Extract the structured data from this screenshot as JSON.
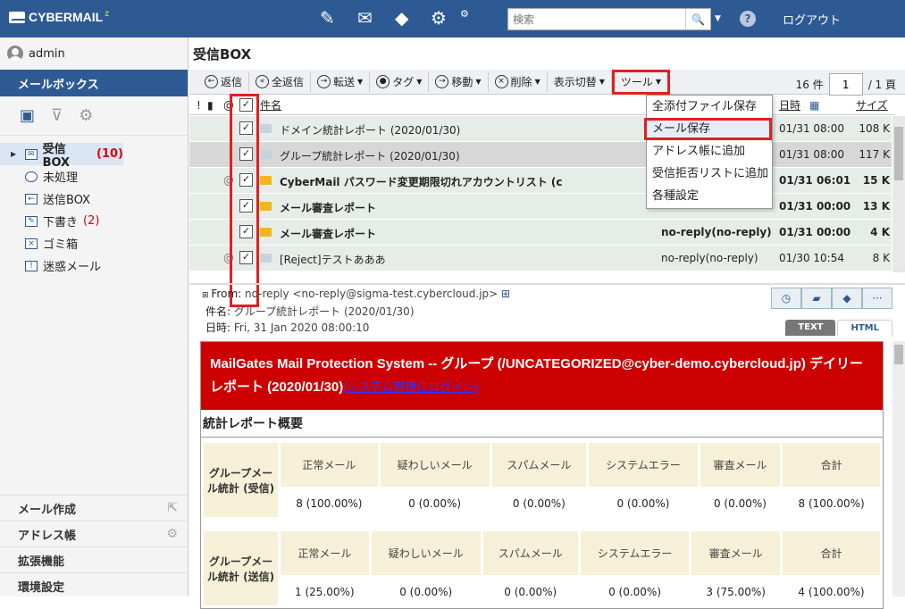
{
  "app": {
    "logo": "CYBERMAIL",
    "search_placeholder": "検索",
    "logout": "ログアウト",
    "help": "?"
  },
  "user": "admin",
  "sidebar": {
    "mailbox_title": "メールボックス",
    "folders": [
      {
        "label": "受信BOX",
        "count": "(10)"
      },
      {
        "label": "未処理",
        "count": ""
      },
      {
        "label": "送信BOX",
        "count": ""
      },
      {
        "label": "下書き",
        "count": "(2)"
      },
      {
        "label": "ゴミ箱",
        "count": ""
      },
      {
        "label": "迷惑メール",
        "count": ""
      }
    ],
    "bottom": [
      "メール作成",
      "アドレス帳",
      "拡張機能",
      "環境設定"
    ]
  },
  "main": {
    "title": "受信BOX",
    "toolbar": {
      "reply": "返信",
      "reply_all": "全返信",
      "forward": "転送",
      "tag": "タグ",
      "move": "移動",
      "delete": "削除",
      "view": "表示切替",
      "tools": "ツール"
    },
    "pager": {
      "count": "16 件",
      "page": "1",
      "total": "/ 1 頁"
    },
    "columns": {
      "subject": "件名",
      "date": "日時",
      "size": "サイズ"
    },
    "rows": [
      {
        "subject": "ドメイン統計レポート (2020/01/30)",
        "from": "",
        "date": "01/31 08:00",
        "size": "108 K",
        "bold": false,
        "att": ""
      },
      {
        "subject": "グループ統計レポート (2020/01/30)",
        "from": "",
        "date": "01/31 08:00",
        "size": "117 K",
        "bold": false,
        "att": ""
      },
      {
        "subject": "CyberMail パスワード変更期限切れアカウントリスト (c",
        "from": "",
        "date": "01/31 06:01",
        "size": "15 K",
        "bold": true,
        "att": "@"
      },
      {
        "subject": "メール審査レポート",
        "from": "",
        "date": "01/31 00:00",
        "size": "13 K",
        "bold": true,
        "att": ""
      },
      {
        "subject": "メール審査レポート",
        "from": "no-reply(no-reply)",
        "date": "01/31 00:00",
        "size": "4 K",
        "bold": true,
        "att": ""
      },
      {
        "subject": "[Reject]テストあああ",
        "from": "no-reply(no-reply)",
        "date": "01/30 10:54",
        "size": "8 K",
        "bold": false,
        "att": "@"
      }
    ],
    "tool_menu": [
      "全添付ファイル保存",
      "メール保存",
      "アドレス帳に追加",
      "受信拒否リストに追加",
      "各種設定"
    ]
  },
  "preview": {
    "from_label": "From:",
    "from": "no-reply <no-reply@sigma-test.cybercloud.jp>",
    "subject_label": "件名:",
    "subject": "グループ統計レポート (2020/01/30)",
    "date_label": "日時:",
    "date": "Fri, 31 Jan 2020 08:00:10",
    "tab_text": "TEXT",
    "tab_html": "HTML"
  },
  "report": {
    "title": "MailGates Mail Protection System -- グループ (/UNCATEGORIZED@cyber-demo.cybercloud.jp) デイリーレポート (2020/01/30)",
    "login_link": "(システム管理にログイン)",
    "section": "統計レポート概要",
    "headers": [
      "正常メール",
      "疑わしいメール",
      "スパムメール",
      "システムエラー",
      "審査メール",
      "合計"
    ],
    "recv_label": "グループメール統計 (受信)",
    "recv": [
      "8 (100.00%)",
      "0 (0.00%)",
      "0 (0.00%)",
      "0 (0.00%)",
      "0 (0.00%)",
      "8 (100.00%)"
    ],
    "send_label": "グループメール統計 (送信)",
    "send": [
      "1 (25.00%)",
      "0 (0.00%)",
      "0 (0.00%)",
      "0 (0.00%)",
      "3 (75.00%)",
      "4 (100.00%)"
    ]
  }
}
